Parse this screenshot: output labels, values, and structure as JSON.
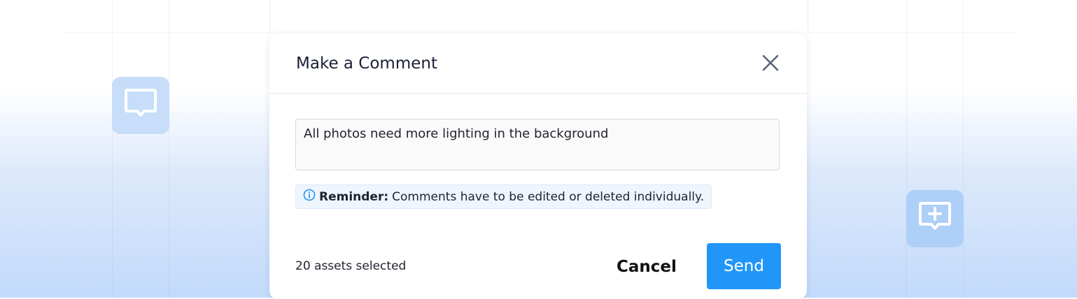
{
  "dialog": {
    "title": "Make a Comment",
    "comment_value": "All photos need more lighting in the background",
    "reminder_label": "Reminder:",
    "reminder_text": "Comments have to be edited or deleted individually.",
    "assets_selected": "20 assets selected",
    "cancel_label": "Cancel",
    "send_label": "Send"
  },
  "icons": {
    "close": "close-icon",
    "info": "info-icon",
    "comment": "comment-icon",
    "add_comment": "add-comment-icon"
  },
  "colors": {
    "accent": "#2196f8",
    "info_bg": "#eef5fd",
    "tile_bg": "#c7ddf9"
  }
}
